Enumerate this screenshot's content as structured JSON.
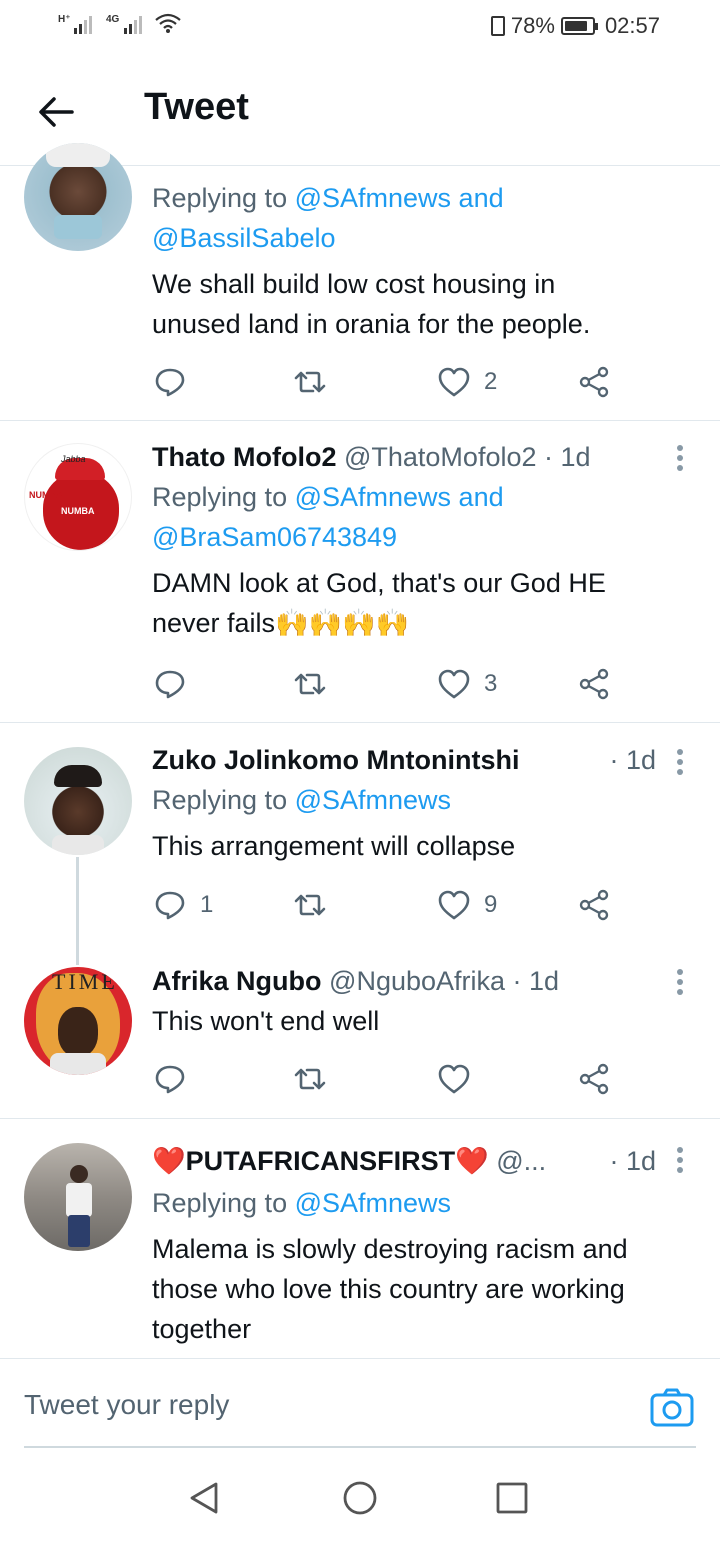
{
  "status_bar": {
    "network_1": "H⁺",
    "network_2": "4G",
    "battery": "78%",
    "time": "02:57"
  },
  "header": {
    "title": "Tweet"
  },
  "tweets": [
    {
      "replying_prefix": "Replying to",
      "reply_mentions": "@SAfmnews and",
      "reply_mentions_2": "@BassilSabelo",
      "text_1": "We shall build low cost housing in",
      "text_2": "unused land in orania for the people.",
      "replies": "",
      "likes": "2"
    },
    {
      "name": "Thato Mofolo2",
      "handle": "@ThatoMofolo2",
      "time": "· 1d",
      "replying_prefix": "Replying to",
      "reply_mentions": "@SAfmnews and",
      "reply_mentions_2": "@BraSam06743849",
      "text_1": "DAMN look at God, that's our God HE",
      "text_2": "never fails🙌🙌🙌🙌",
      "replies": "",
      "likes": "3"
    },
    {
      "name": "Zuko Jolinkomo Mntonintshi",
      "time": "· 1d",
      "replying_prefix": "Replying to",
      "reply_mentions": "@SAfmnews",
      "text_1": "This arrangement will collapse",
      "replies": "1",
      "likes": "9"
    },
    {
      "name": "Afrika Ngubo",
      "handle": "@NguboAfrika",
      "time": "· 1d",
      "text_1": "This won't end well",
      "replies": "",
      "likes": ""
    },
    {
      "name": "❤️PUTAFRICANSFIRST❤️",
      "handle": "@...",
      "time": "· 1d",
      "replying_prefix": "Replying to",
      "reply_mentions": "@SAfmnews",
      "text_1": "Malema is slowly destroying racism and",
      "text_2": "those who love this country are working",
      "text_3": "together"
    }
  ],
  "reply_bar": {
    "placeholder": "Tweet your reply"
  },
  "icons": {
    "back": "arrow-left-icon",
    "reply": "reply-icon",
    "retweet": "retweet-icon",
    "like": "heart-icon",
    "share": "share-icon",
    "camera": "camera-icon"
  },
  "colors": {
    "accent": "#1d9bf0",
    "muted": "#536471",
    "divider": "#e1e8ed"
  }
}
